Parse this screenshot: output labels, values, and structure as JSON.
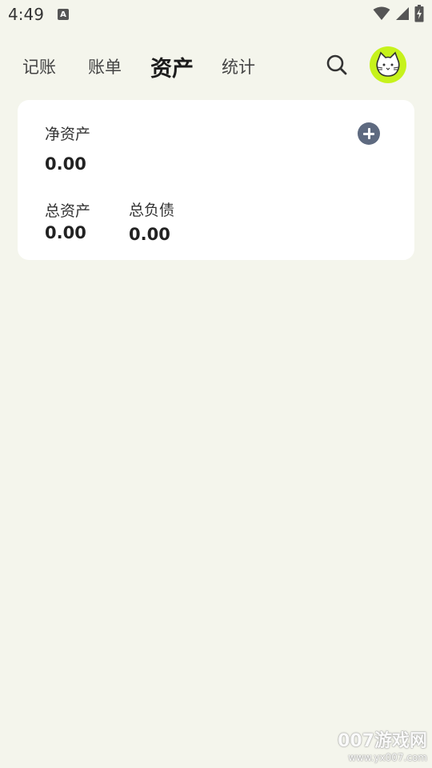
{
  "status_bar": {
    "time": "4:49",
    "notification_icon": "A"
  },
  "nav": {
    "tabs": [
      {
        "label": "记账",
        "active": false
      },
      {
        "label": "账单",
        "active": false
      },
      {
        "label": "资产",
        "active": true
      },
      {
        "label": "统计",
        "active": false
      }
    ],
    "search_icon": "search-icon",
    "avatar_icon": "cat-avatar-icon"
  },
  "card": {
    "net_assets_label": "净资产",
    "net_assets_value": "0.00",
    "total_assets_label": "总资产",
    "total_assets_value": "0.00",
    "total_liabilities_label": "总负债",
    "total_liabilities_value": "0.00",
    "add_icon": "plus-circle-icon"
  },
  "watermark": {
    "main": "007游戏网",
    "url": "www.yx007.com"
  },
  "colors": {
    "background": "#f4f5ec",
    "card": "#ffffff",
    "avatar": "#c6f21b",
    "add_button": "#5e6a80"
  }
}
